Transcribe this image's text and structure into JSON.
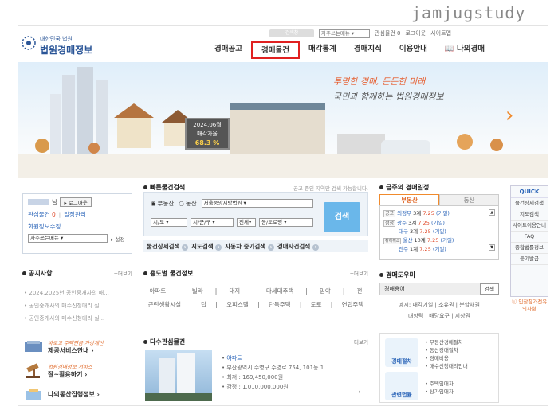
{
  "watermark": "jamjugstudy",
  "header": {
    "logo_small": "대한민국 법원",
    "logo_main": "법원경매정보",
    "util_search": "검색창",
    "util_select": "자주쓰는메뉴",
    "util_links": [
      "관심물건 0",
      "로그아웃",
      "사이트맵"
    ],
    "nav": [
      "경매공고",
      "경매물건",
      "매각통계",
      "경매지식",
      "이용안내",
      "나의경매"
    ]
  },
  "banner": {
    "slogan1": "투명한 경매, 든든한 미래",
    "slogan2": "국민과 함께하는 법원경매정보",
    "board_date": "2024.06월",
    "board_label": "매각가율",
    "board_value": "68.3 %"
  },
  "login": {
    "user_suffix": "님",
    "logout_label": "로그아웃",
    "interest_label": "관심물건",
    "interest_count": "0",
    "schedule_label": "일정관리",
    "member_label": "회원정보수정",
    "menu_select": "자주쓰는메뉴",
    "settings_label": "설정"
  },
  "notice": {
    "title": "공지사항",
    "more": "더보기",
    "items": [
      "2024,2025년 공인중개사의 매...",
      "공인중개사의 매수신청대리 실...",
      "공인중개사의 매수신청대리 실..."
    ]
  },
  "services": [
    {
      "hw": "바로고 주택연금 가상계산",
      "label": "제공서비스안내"
    },
    {
      "hw": "법원경매정보 서비스",
      "label": "잘~활용하기"
    },
    {
      "hw": "",
      "label": "나의동산집행정보"
    }
  ],
  "quick_search": {
    "title": "빠른물건검색",
    "notice_text": "공고 중인 지역만 검색 가능합니다.",
    "radio_realty": "부동산",
    "radio_movable": "동산",
    "court_select": "서울중앙지방법원",
    "sido": "시/도",
    "sigungu": "시/군/구",
    "all": "전체",
    "dong": "동/도로명",
    "search_label": "검색",
    "links": [
      "물건상세검색",
      "지도검색",
      "자동차 중기검색",
      "경매사건검색"
    ]
  },
  "use_search": {
    "title": "용도별 물건정보",
    "more": "더보기",
    "rows": [
      [
        "아파트",
        "빌라",
        "대지",
        "다세대주택",
        "임야",
        "전"
      ],
      [
        "근린생활시설",
        "답",
        "오피스텔",
        "단독주택",
        "도로",
        "연립주택"
      ]
    ]
  },
  "multi_interest": {
    "title": "다수관심물건",
    "more": "더보기",
    "type": "아파트",
    "address": "부산광역시 수영구 수영로 754, 101동 1...",
    "min_label": "최저",
    "min_value": "169,450,000원",
    "appraisal_label": "감정",
    "appraisal_value": "1,010,000,000원"
  },
  "schedule": {
    "title": "금주의 경매일정",
    "tab_realty": "부동산",
    "tab_movable": "동산",
    "rows": [
      {
        "tag": "공고",
        "court": "의정부",
        "count": "3계",
        "date": "7.25",
        "day": "(기일)"
      },
      {
        "tag": "정정",
        "court": "광주",
        "count": "3계",
        "date": "7.25",
        "day": "(기일)"
      },
      {
        "tag": "",
        "court": "대구",
        "count": "3계",
        "date": "7.25",
        "day": "(기일)"
      },
      {
        "tag": "취하취소",
        "court": "울산",
        "count": "10계",
        "date": "7.25",
        "day": "(기일)"
      },
      {
        "tag": "",
        "court": "진주",
        "count": "1계",
        "date": "7.25",
        "day": "(기일)"
      }
    ]
  },
  "dictionary": {
    "title": "경매도우미",
    "input_label": "경매용어",
    "search_label": "검색",
    "line1": "예시: 매각기일 | 소유권 | 분할채권",
    "line2": "대항력 | 배당요구 | 지상권"
  },
  "process": {
    "icon1_label": "경매절차",
    "icon2_label": "관련법률",
    "list1": [
      "부동산경매절차",
      "동산경매절차",
      "경매비용",
      "매수신청대리안내"
    ],
    "list2": [
      "주택임대차",
      "상가임대차"
    ]
  },
  "quick_menu": {
    "head": "QUICK",
    "items": [
      "물건상세검색",
      "지도검색",
      "사이트이용안내",
      "FAQ",
      "종합법률정보",
      "등기발급"
    ],
    "extra": "입찰참가전유의사항"
  },
  "colors": {
    "brand": "#2a5597",
    "accent": "#f08a2c",
    "highlight_border": "#e02020",
    "search_button": "#6ab7ea"
  }
}
